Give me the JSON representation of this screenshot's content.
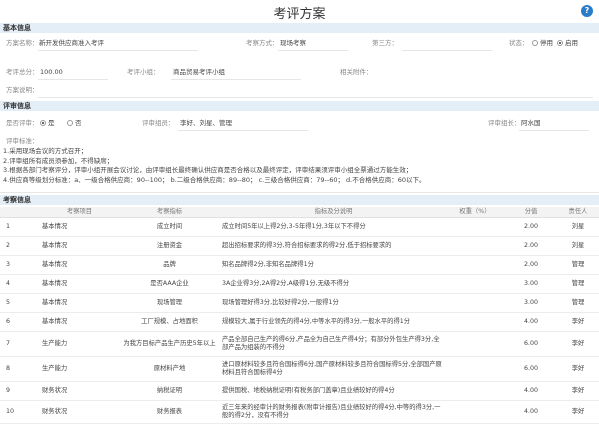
{
  "window": {
    "title": "考评方案"
  },
  "sections": {
    "basic": "基本信息",
    "review": "评审信息",
    "assess": "考察信息"
  },
  "basic": {
    "plan_name_label": "方案名称：",
    "plan_name_value": "新开发供应商准入考评",
    "method_label": "考察方式：",
    "method_value": "现场考察",
    "third_party_label": "第三方：",
    "status_label": "状态：",
    "status_disabled": "停用",
    "status_enabled": "启用",
    "total_score_label": "考评总分：",
    "total_score_value": "100.00",
    "group_label": "考评小组：",
    "group_value": "商品贸易考评小组",
    "attachment_label": "相关附件：",
    "description_label": "方案说明："
  },
  "review": {
    "needs_review_label": "是否评审：",
    "yes": "是",
    "no": "否",
    "members_label": "评审组员：",
    "members_value": "李好、刘星、管理",
    "leader_label": "评审组长：",
    "leader_value": "阿水国",
    "criteria_label": "评审标准：",
    "criteria_lines": [
      "1.采用现场会议的方式召开；",
      "2.评审组所有成员须参加，不得缺席；",
      "3.根据各部门考察评分，评审小组开展会议讨论，由评审组长最终确认供应商是否合格以及最终评定，评审结果须评审小组全票通过方能生效；",
      "4.供应商等级划分标准：a、一级合格供应商：90--100； b.二级合格供应商：89--80； c.三级合格供应商：79--60； d.不合格供应商：60以下。"
    ]
  },
  "assess": {
    "headers": [
      "",
      "考察项目",
      "考察指标",
      "指标及分说明",
      "权重（%）",
      "分值",
      "责任人"
    ],
    "rows": [
      [
        "1",
        "基本情况",
        "成立时间",
        "成立时间5年以上得2分,3-5年得1分,3年以下不得分",
        "",
        "2.00",
        "刘星"
      ],
      [
        "2",
        "基本情况",
        "注册资金",
        "超出招标要求的得3分,符合招标要求的得2分,低于招标要求的",
        "",
        "2.00",
        "刘星"
      ],
      [
        "3",
        "基本情况",
        "品牌",
        "知名品牌得2分,非知名品牌得1分",
        "",
        "2.00",
        "管理"
      ],
      [
        "4",
        "基本情况",
        "是否AAA企业",
        "3A企业得3分,2A得2分,A级得1分,无级不得分",
        "",
        "3.00",
        "管理"
      ],
      [
        "5",
        "基本情况",
        "现场管理",
        "现场管理好得3分,比较好得2分,一般得1分",
        "",
        "3.00",
        "管理"
      ],
      [
        "6",
        "基本情况",
        "工厂规模、占地面积",
        "规模较大,属于行业领先的得4分,中等水平的得3分,一般水平的得1分",
        "",
        "4.00",
        "李好"
      ],
      [
        "7",
        "生产能力",
        "为我方目标产品生产历史5年以上",
        "产品全部自己生产的得6分,产品全为自己生产得4分；有部分外包生产得3分,全部产品为组装的不得分",
        "",
        "6.00",
        "李好"
      ],
      [
        "8",
        "生产能力",
        "原材料产地",
        "进口原材料较多且符合国标得6分,国产原材料较多且符合国标得5分,全部国产原材料且符合国标得4分",
        "",
        "6.00",
        "李好"
      ],
      [
        "9",
        "财务状况",
        "纳税证明",
        "提供国税、地税纳税证明(有税务部门盖章)且业绩较好的得4分",
        "",
        "4.00",
        "李好"
      ],
      [
        "10",
        "财务状况",
        "财务报表",
        "近三年来的经审计的财务报表(附审计报告)且业绩较好的得4分,中等的得3分,一般的得2分，没有不得分",
        "",
        "4.00",
        "李好"
      ]
    ]
  }
}
